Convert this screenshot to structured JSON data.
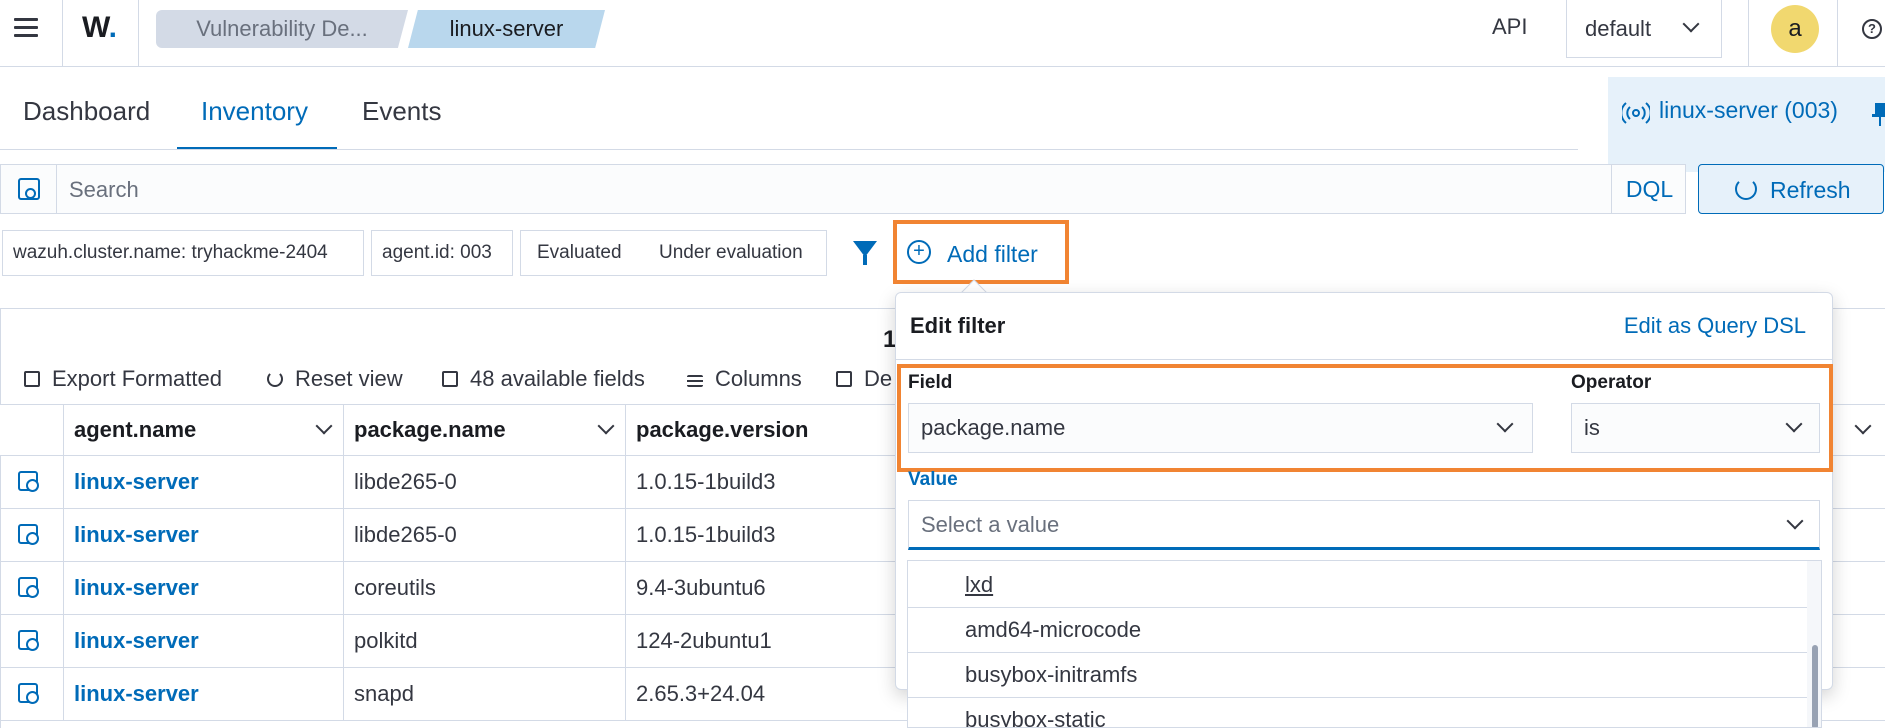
{
  "header": {
    "logo_text": "W",
    "breadcrumbs": [
      "Vulnerability De...",
      "linux-server"
    ],
    "api_label": "API",
    "tenant": "default",
    "avatar_initial": "a",
    "help_glyph": "?"
  },
  "tabs": [
    {
      "label": "Dashboard",
      "active": false
    },
    {
      "label": "Inventory",
      "active": true
    },
    {
      "label": "Events",
      "active": false
    }
  ],
  "agent_selector": {
    "label": "linux-server (003)"
  },
  "search": {
    "placeholder": "Search",
    "language": "DQL",
    "refresh_label": "Refresh"
  },
  "filters": {
    "pills": [
      "wazuh.cluster.name: tryhackme-2404",
      "agent.id: 003"
    ],
    "group_options": [
      "Evaluated",
      "Under evaluation"
    ],
    "add_filter_label": "Add filter"
  },
  "table": {
    "hits_count_partial": "1",
    "toolbar": [
      "Export Formatted",
      "Reset view",
      "48 available fields",
      "Columns",
      "De"
    ],
    "columns": [
      "agent.name",
      "package.name",
      "package.version"
    ],
    "rows": [
      {
        "agent": "linux-server",
        "package": "libde265-0",
        "version": "1.0.15-1build3"
      },
      {
        "agent": "linux-server",
        "package": "libde265-0",
        "version": "1.0.15-1build3"
      },
      {
        "agent": "linux-server",
        "package": "coreutils",
        "version": "9.4-3ubuntu6"
      },
      {
        "agent": "linux-server",
        "package": "polkitd",
        "version": "124-2ubuntu1"
      },
      {
        "agent": "linux-server",
        "package": "snapd",
        "version": "2.65.3+24.04"
      }
    ]
  },
  "edit_filter": {
    "title": "Edit filter",
    "query_dsl_link": "Edit as Query DSL",
    "field_label": "Field",
    "field_value": "package.name",
    "operator_label": "Operator",
    "operator_value": "is",
    "value_label": "Value",
    "value_placeholder": "Select a value",
    "options": [
      "lxd",
      "amd64-microcode",
      "busybox-initramfs",
      "busybox-static"
    ]
  },
  "colors": {
    "accent": "#006bb8",
    "highlight": "#f18432",
    "avatar": "#f1d86f"
  }
}
